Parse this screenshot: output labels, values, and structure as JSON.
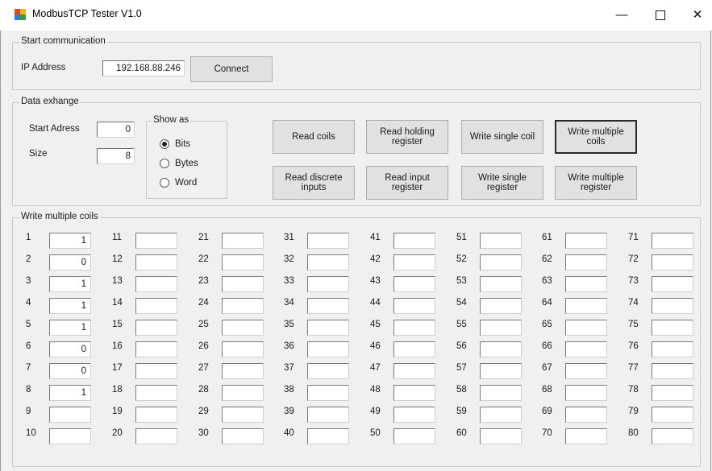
{
  "window": {
    "title": "ModbusTCP Tester V1.0",
    "minimize": "—",
    "close": "✕"
  },
  "communication": {
    "legend": "Start communication",
    "ip_label": "IP Address",
    "ip_value": "192.168.88.246",
    "connect_label": "Connect"
  },
  "exchange": {
    "legend": "Data exhange",
    "start_label": "Start Adress",
    "start_value": "0",
    "size_label": "Size",
    "size_value": "8",
    "show_as": {
      "legend": "Show as",
      "options": [
        "Bits",
        "Bytes",
        "Word"
      ],
      "selected": "Bits"
    },
    "buttons": {
      "read_coils": "Read coils",
      "read_holding": "Read holding\nregister",
      "write_single_coil": "Write single coil",
      "write_multiple_coils": "Write multiple\ncoils",
      "read_discrete": "Read discrete\ninputs",
      "read_input": "Read input\nregister",
      "write_single_register": "Write single\nregister",
      "write_multiple_register": "Write multiple\nregister"
    }
  },
  "coils": {
    "legend": "Write multiple coils",
    "values": [
      "1",
      "0",
      "1",
      "1",
      "1",
      "0",
      "0",
      "1",
      "",
      "",
      "",
      "",
      "",
      "",
      "",
      "",
      "",
      "",
      "",
      "",
      "",
      "",
      "",
      "",
      "",
      "",
      "",
      "",
      "",
      "",
      "",
      "",
      "",
      "",
      "",
      "",
      "",
      "",
      "",
      "",
      "",
      "",
      "",
      "",
      "",
      "",
      "",
      "",
      "",
      "",
      "",
      "",
      "",
      "",
      "",
      "",
      "",
      "",
      "",
      "",
      "",
      "",
      "",
      "",
      "",
      "",
      "",
      "",
      "",
      "",
      "",
      "",
      "",
      "",
      "",
      "",
      "",
      ""
    ]
  }
}
